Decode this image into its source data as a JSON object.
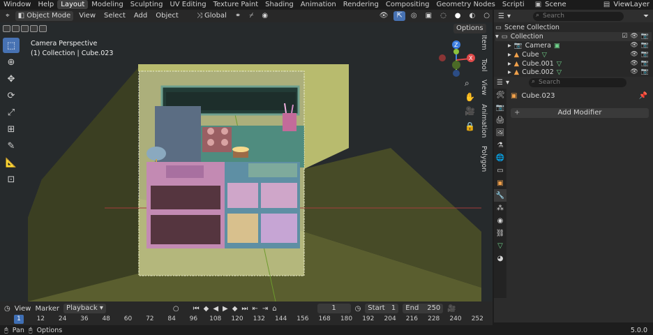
{
  "topbar": {
    "menus": [
      "Window",
      "Help"
    ],
    "workspaces": [
      "Layout",
      "Modeling",
      "Sculpting",
      "UV Editing",
      "Texture Paint",
      "Shading",
      "Animation",
      "Rendering",
      "Compositing",
      "Geometry Nodes",
      "Scripti"
    ],
    "active_workspace": "Layout",
    "scene_label": "Scene",
    "viewlayer_label": "ViewLayer"
  },
  "viewport_header": {
    "mode": "Object Mode",
    "menus": [
      "View",
      "Select",
      "Add",
      "Object"
    ],
    "transform_orientation": "Global",
    "options_label": "Options"
  },
  "viewport": {
    "camera_label": "Camera Perspective",
    "object_info": "(1) Collection | Cube.023"
  },
  "npanel_tabs": [
    "Item",
    "Tool",
    "View",
    "Animation",
    "Polygon"
  ],
  "outliner": {
    "search_placeholder": "Search",
    "scene_collection": "Scene Collection",
    "collection": "Collection",
    "items": [
      "Camera",
      "Cube",
      "Cube.001",
      "Cube.002"
    ]
  },
  "properties": {
    "search_placeholder": "Search",
    "object_name": "Cube.023",
    "add_modifier_label": "Add Modifier"
  },
  "timeline": {
    "menus": [
      "View",
      "Marker",
      "Playback"
    ],
    "current_frame": "1",
    "start_label": "Start",
    "start_value": "1",
    "end_label": "End",
    "end_value": "250",
    "ruler_labels": [
      "1",
      "12",
      "24",
      "36",
      "48",
      "60",
      "72",
      "84",
      "96",
      "108",
      "120",
      "132",
      "144",
      "156",
      "168",
      "180",
      "192",
      "204",
      "216",
      "228",
      "240",
      "252"
    ]
  },
  "statusbar": {
    "pan_label": "Pan",
    "options_label": "Options",
    "version": "5.0.0"
  },
  "colors": {
    "accent": "#4772b3",
    "active_frame": "#3f6fb5",
    "gizmo_x": "#e04a4a",
    "gizmo_y": "#8bc23c",
    "gizmo_z": "#3c7ee0"
  }
}
